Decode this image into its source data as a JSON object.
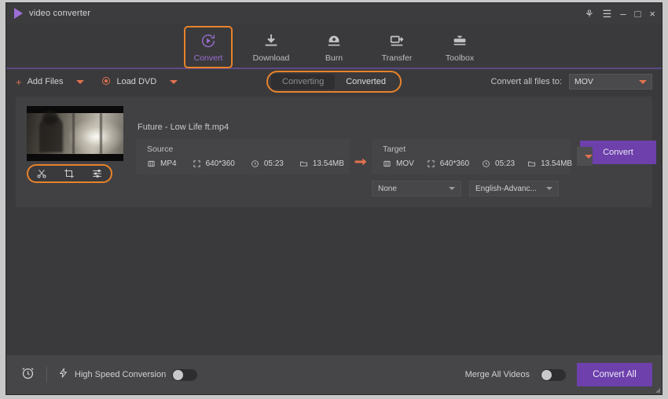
{
  "window": {
    "title": "video converter",
    "controls": [
      {
        "name": "account-icon",
        "glyph": "⚘"
      },
      {
        "name": "menu-icon",
        "glyph": "☰"
      },
      {
        "name": "minimize-icon",
        "glyph": "–"
      },
      {
        "name": "maximize-icon",
        "glyph": "□"
      },
      {
        "name": "close-icon",
        "glyph": "×"
      }
    ]
  },
  "nav": {
    "items": [
      {
        "label": "Convert",
        "icon": "convert-icon",
        "active": true
      },
      {
        "label": "Download",
        "icon": "download-icon",
        "active": false
      },
      {
        "label": "Burn",
        "icon": "burn-icon",
        "active": false
      },
      {
        "label": "Transfer",
        "icon": "transfer-icon",
        "active": false
      },
      {
        "label": "Toolbox",
        "icon": "toolbox-icon",
        "active": false
      }
    ]
  },
  "toolbar": {
    "add_files": "Add Files",
    "load_dvd": "Load DVD",
    "tab_converting": "Converting",
    "tab_converted": "Converted",
    "convert_all_to_label": "Convert all files to:",
    "convert_all_to_value": "MOV"
  },
  "file": {
    "name": "Future - Low Life ft.mp4",
    "source": {
      "title": "Source",
      "format": "MP4",
      "resolution": "640*360",
      "duration": "05:23",
      "size": "13.54MB"
    },
    "target": {
      "title": "Target",
      "format": "MOV",
      "resolution": "640*360",
      "duration": "05:23",
      "size": "13.54MB"
    },
    "subtitle_select": "None",
    "audio_select": "English-Advanc...",
    "convert_button": "Convert",
    "edit_tools": [
      {
        "name": "trim-icon"
      },
      {
        "name": "crop-icon"
      },
      {
        "name": "effect-icon"
      }
    ]
  },
  "footer": {
    "high_speed_label": "High Speed Conversion",
    "high_speed_on": false,
    "merge_label": "Merge All Videos",
    "merge_on": false,
    "convert_all_button": "Convert All"
  },
  "colors": {
    "accent_purple": "#6d40ac",
    "accent_orange": "#e8822a",
    "panel": "#454547",
    "window_bg": "#3a3a3c"
  }
}
